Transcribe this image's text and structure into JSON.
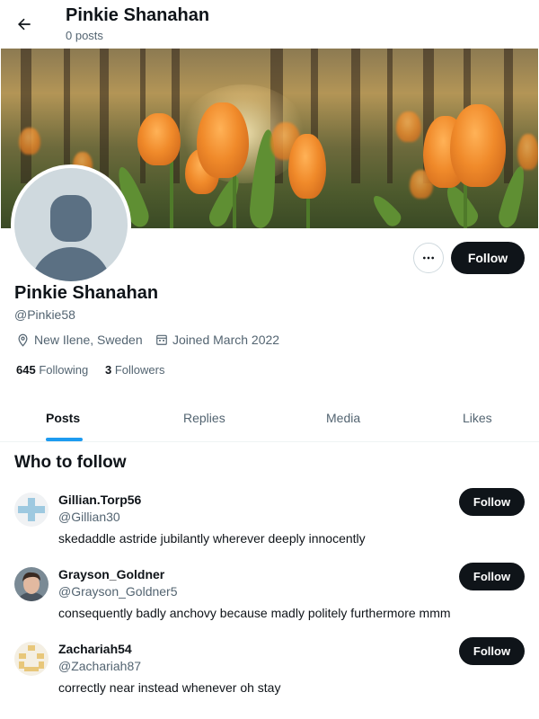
{
  "header": {
    "title": "Pinkie Shanahan",
    "post_count": "0 posts"
  },
  "profile": {
    "name": "Pinkie Shanahan",
    "handle": "@Pinkie58",
    "location": "New Ilene, Sweden",
    "joined": "Joined March 2022",
    "following_count": "645",
    "following_label": "Following",
    "followers_count": "3",
    "followers_label": "Followers",
    "follow_label": "Follow"
  },
  "tabs": [
    {
      "label": "Posts",
      "active": true
    },
    {
      "label": "Replies",
      "active": false
    },
    {
      "label": "Media",
      "active": false
    },
    {
      "label": "Likes",
      "active": false
    }
  ],
  "who_to_follow": {
    "title": "Who to follow",
    "users": [
      {
        "name": "Gillian.Torp56",
        "handle": "@Gillian30",
        "bio": "skedaddle astride jubilantly wherever deeply innocently",
        "follow_label": "Follow"
      },
      {
        "name": "Grayson_Goldner",
        "handle": "@Grayson_Goldner5",
        "bio": "consequently badly anchovy because madly politely furthermore mmm",
        "follow_label": "Follow"
      },
      {
        "name": "Zachariah54",
        "handle": "@Zachariah87",
        "bio": "correctly near instead whenever oh stay",
        "follow_label": "Follow"
      }
    ]
  },
  "icons": {
    "back": "arrow-left-icon",
    "more": "more-horizontal-icon",
    "location": "location-pin-icon",
    "calendar": "calendar-icon"
  },
  "colors": {
    "accent": "#1d9bf0",
    "primary_text": "#0f1419",
    "secondary_text": "#536471",
    "button_bg": "#0f1419"
  }
}
